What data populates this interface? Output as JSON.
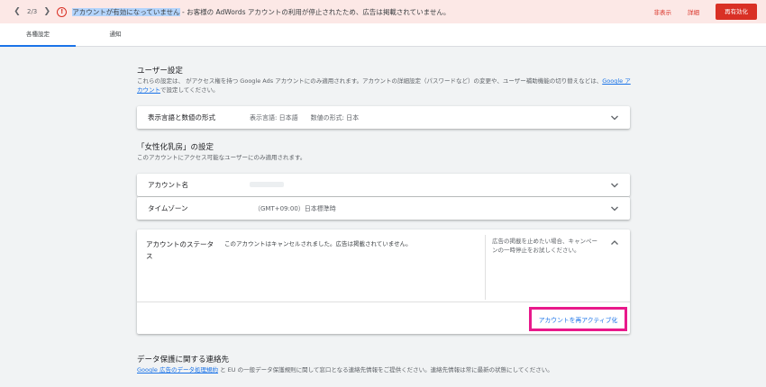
{
  "banner": {
    "counter": "2/3",
    "alert_highlight": "アカウントが有効になっていません",
    "alert_rest": " - お客様の AdWords アカウントの利用が停止されたため、広告は掲載されていません。",
    "hide_label": "非表示",
    "details_label": "詳細",
    "reactivate_label": "再有効化",
    "accent_color": "#d93025"
  },
  "tabs": [
    {
      "label": "各種設定",
      "active": true
    },
    {
      "label": "通知",
      "active": false
    }
  ],
  "user_settings": {
    "title": "ユーザー設定",
    "desc_before_link": "これらの設定は、 がアクセス権を持つ Google Ads アカウントにのみ適用されます。アカウントの詳細設定（パスワードなど）の変更や、ユーザー補助機能の切り替えなどは、",
    "desc_link": "Google アカウント",
    "desc_after_link": "で設定してください。",
    "row": {
      "label": "表示言語と数値の形式",
      "value": "表示言語: 日本語　　数値の形式: 日本"
    }
  },
  "account_settings": {
    "title": "「女性化乳房」の設定",
    "desc": "このアカウントにアクセス可能なユーザーにのみ適用されます。",
    "rows": [
      {
        "label": "アカウント名",
        "value": ""
      },
      {
        "label": "タイムゾーン",
        "value": "（GMT+09:00）日本標準時"
      }
    ]
  },
  "account_status": {
    "label": "アカウントのステータス",
    "text": "このアカウントはキャンセルされました。広告は掲載されていません。",
    "help": "広告の掲載を止めたい場合、キャンペーンの一時停止をお試しください。",
    "reactivate_link": "アカウントを再アクティブ化",
    "highlight_color": "#e8198b"
  },
  "data_protection": {
    "title": "データ保護に関する連絡先",
    "link": "Google 広告のデータ処理規約",
    "desc": " と EU の一般データ保護規則に関して窓口となる連絡先情報をご提供ください。連絡先情報は常に最新の状態にしてください。"
  }
}
